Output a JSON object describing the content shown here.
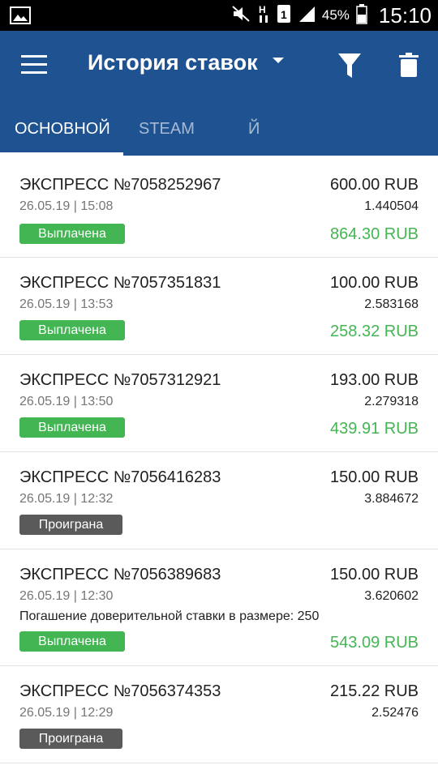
{
  "status_bar": {
    "battery": "45%",
    "time": "15:10",
    "icons": [
      "image-icon",
      "mute-icon",
      "data-h-icon",
      "sim1-icon",
      "signal-icon",
      "battery-icon"
    ]
  },
  "app_bar": {
    "title": "История ставок",
    "colors": {
      "primary": "#1f5290",
      "won_badge": "#43b653",
      "lost_badge": "#5a5a5a",
      "payout": "#43b653"
    }
  },
  "tabs": [
    {
      "label": "ОСНОВНОЙ",
      "active": true
    },
    {
      "label": "STEAM",
      "active": false
    },
    {
      "label": "Й",
      "active": false
    }
  ],
  "bets": [
    {
      "name": "ЭКСПРЕСС №7058252967",
      "amount": "600.00 RUB",
      "datetime": "26.05.19 | 15:08",
      "coef": "1.440504",
      "status": "Выплачена",
      "won": true,
      "payout": "864.30 RUB",
      "note": ""
    },
    {
      "name": "ЭКСПРЕСС №7057351831",
      "amount": "100.00 RUB",
      "datetime": "26.05.19 | 13:53",
      "coef": "2.583168",
      "status": "Выплачена",
      "won": true,
      "payout": "258.32 RUB",
      "note": ""
    },
    {
      "name": "ЭКСПРЕСС №7057312921",
      "amount": "193.00 RUB",
      "datetime": "26.05.19 | 13:50",
      "coef": "2.279318",
      "status": "Выплачена",
      "won": true,
      "payout": "439.91 RUB",
      "note": ""
    },
    {
      "name": "ЭКСПРЕСС №7056416283",
      "amount": "150.00 RUB",
      "datetime": "26.05.19 | 12:32",
      "coef": "3.884672",
      "status": "Проиграна",
      "won": false,
      "payout": "",
      "note": ""
    },
    {
      "name": "ЭКСПРЕСС №7056389683",
      "amount": "150.00 RUB",
      "datetime": "26.05.19 | 12:30",
      "coef": "3.620602",
      "status": "Выплачена",
      "won": true,
      "payout": "543.09 RUB",
      "note": "Погашение доверительной ставки в размере: 250"
    },
    {
      "name": "ЭКСПРЕСС №7056374353",
      "amount": "215.22 RUB",
      "datetime": "26.05.19 | 12:29",
      "coef": "2.52476",
      "status": "Проиграна",
      "won": false,
      "payout": "",
      "note": ""
    }
  ]
}
